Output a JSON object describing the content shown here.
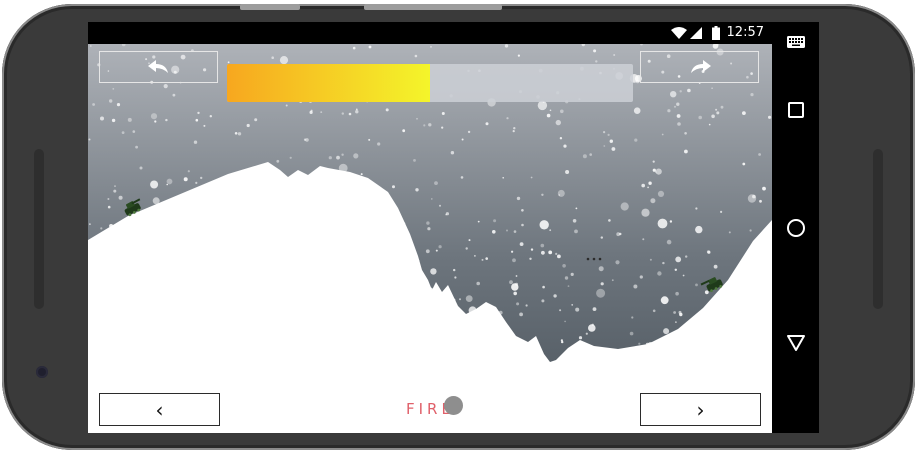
{
  "status_bar": {
    "time": "12:57",
    "icons": [
      "wifi-icon",
      "cell-signal-icon",
      "battery-icon"
    ]
  },
  "nav_bar": {
    "icons": [
      "keyboard-icon",
      "recents-icon",
      "home-icon",
      "back-icon"
    ]
  },
  "game": {
    "undo_icon": "undo-arrow-icon",
    "redo_icon": "redo-arrow-icon",
    "power_level": 0.5,
    "power_colors": {
      "start": "#f7a71f",
      "end": "#f4f52a",
      "track": "#cdd0d6"
    },
    "fire_label": "FIRE",
    "aim_left_label": "‹",
    "aim_right_label": "›",
    "sky_colors": {
      "top": "#a9adb3",
      "bottom": "#4b545c"
    },
    "tank_color": "#1f3a1a",
    "fire_color": "#e0606a"
  }
}
